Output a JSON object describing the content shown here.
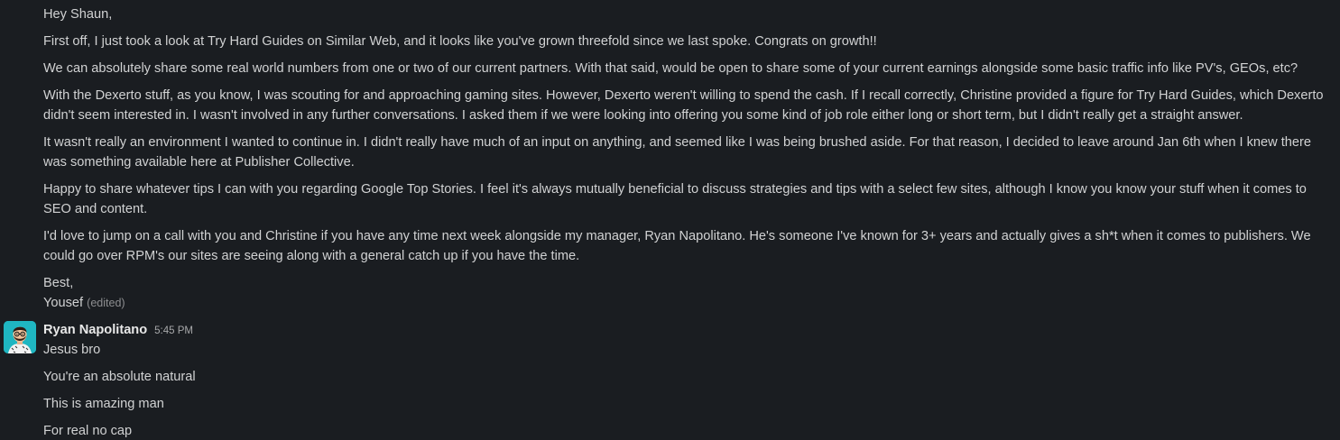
{
  "first_message": {
    "paragraphs": [
      "Hey Shaun,",
      "First off, I just took a look at Try Hard Guides on Similar Web, and it looks like you've grown threefold since we last spoke. Congrats on growth!!",
      "We can absolutely share some real world numbers from one or two of our current partners. With that said, would be open to share some of your current earnings alongside some basic traffic info like PV's, GEOs, etc?",
      "With the Dexerto stuff, as you know, I was scouting for and approaching gaming sites. However, Dexerto weren't willing to spend the cash. If I recall correctly, Christine provided a figure for Try Hard Guides, which Dexerto didn't seem interested in. I wasn't involved in any further conversations. I asked them if we were looking into offering you some kind of job role either long or short term, but I didn't really get a straight answer.",
      "It wasn't really an environment I wanted to continue in. I didn't really have much of an input on anything, and seemed like I was being brushed aside. For that reason, I decided to leave around Jan 6th when I knew there was something available here at Publisher Collective.",
      "Happy to share whatever tips I can with you regarding Google Top Stories. I feel it's always mutually beneficial to discuss strategies and tips with a select few sites, although I know you know your stuff when it comes to SEO and content.",
      "I'd love to jump on a call with you and Christine if you have any time next week alongside my manager, Ryan Napolitano. He's someone I've known for 3+ years and actually gives a sh*t when it comes to publishers. We could go over RPM's our sites are seeing along with a general catch up if you have the time."
    ],
    "signoff_line1": "Best,",
    "signoff_line2": "Yousef",
    "edited_label": "(edited)"
  },
  "second_message": {
    "author": "Ryan Napolitano",
    "time": "5:45 PM",
    "avatar_icon": "cartoon-man-avatar-icon",
    "lines": [
      "Jesus bro",
      "You're an absolute natural",
      "This is amazing man",
      "For real no cap"
    ]
  },
  "colors": {
    "background": "#1a1d21",
    "text": "#d1d2d3",
    "muted": "#8d8e90",
    "avatar_bg": "#1fb6c1"
  }
}
